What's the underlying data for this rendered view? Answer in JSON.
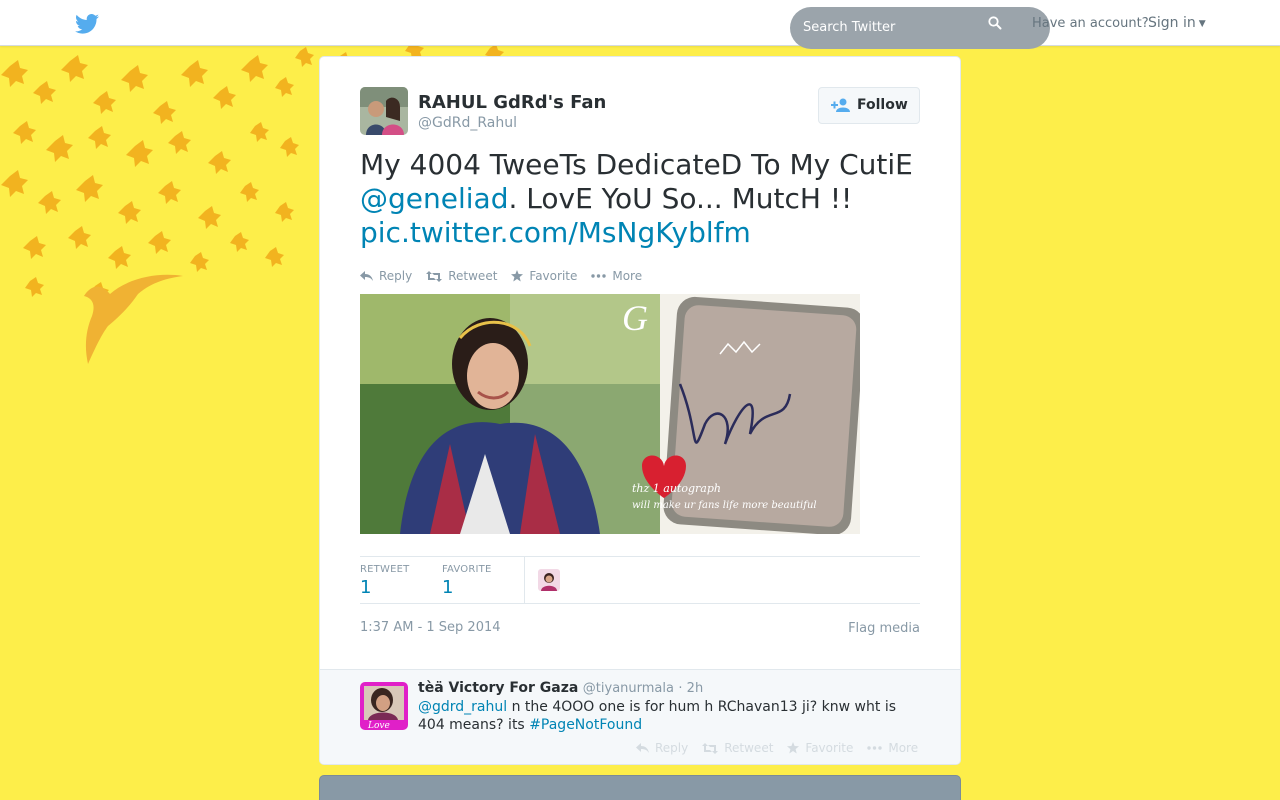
{
  "colors": {
    "background": "#fdee4a",
    "link": "#0084b4",
    "twitter_blue": "#55acee",
    "muted": "#8899a6"
  },
  "topbar": {
    "logo_icon": "twitter-bird-icon",
    "search_placeholder": "Search Twitter",
    "search_icon": "search-icon",
    "have_account": "Have an account?",
    "sign_in": "Sign in"
  },
  "tweet": {
    "display_name": "RAHUL GdRd's Fan",
    "screen_name": "@GdRd_Rahul",
    "follow_label": "Follow",
    "text_part1": "My 4004 TweeTs DedicateD To My CutiE ",
    "mention": "@geneliad",
    "text_part2": ". LovE YoU So... MutcH !! ",
    "pic_link": "pic.twitter.com/MsNgKyblfm",
    "actions": {
      "reply": "Reply",
      "retweet": "Retweet",
      "favorite": "Favorite",
      "more": "More"
    },
    "media": {
      "caption_line1": "thz 1 autograph",
      "caption_line2": "will make ur fans life more beautiful"
    },
    "stats": {
      "retweet_label": "RETWEET",
      "retweet_count": "1",
      "favorite_label": "FAVORITE",
      "favorite_count": "1"
    },
    "timestamp": "1:37 AM - 1 Sep 2014",
    "flag_media": "Flag media"
  },
  "reply": {
    "display_name": "tèä Victory For Gaza",
    "screen_name": "@tiyanurmala",
    "time": "· 2h",
    "mention": "@gdrd_rahul",
    "text": " n the 4OOO one is for hum h RChavan13 ji? knw wht is 404 means? its ",
    "hashtag": "#PageNotFound",
    "actions": {
      "reply": "Reply",
      "retweet": "Retweet",
      "favorite": "Favorite",
      "more": "More"
    }
  }
}
